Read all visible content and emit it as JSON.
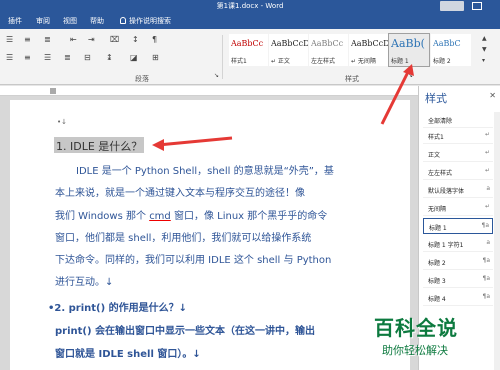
{
  "window": {
    "title": "第1课1.docx  -  Word"
  },
  "ribbon_tabs": [
    "插件",
    "审阅",
    "视图",
    "帮助"
  ],
  "tell_me": "操作说明搜索",
  "ribbon": {
    "group_paragraph": "段落",
    "group_styles": "样式",
    "styles": [
      {
        "sample": "AaBbCc",
        "name": "样式1"
      },
      {
        "sample": "AaBbCcD",
        "name": "↵ 正文"
      },
      {
        "sample": "AaBbCc",
        "name": "左左样式"
      },
      {
        "sample": "AaBbCcD",
        "name": "↵ 无间隔"
      },
      {
        "sample": "AaBb(",
        "name": "标题 1"
      },
      {
        "sample": "AaBbC",
        "name": "标题 2"
      }
    ]
  },
  "document": {
    "anchor": "•↓",
    "heading1": "1. IDLE  是什么？",
    "para1": [
      "IDLE 是一个 Python Shell，shell 的意思就是“外壳”，基",
      "本上来说，就是一个通过键入文本与程序交互的途径！像",
      "我们 Windows 那个 ",
      "cmd",
      " 窗口，像 Linux 那个黑乎乎的命令",
      "窗口，他们都是 shell，利用他们，我们就可以给操作系统",
      "下达命令。同样的，我们可以利用 IDLE 这个 shell 与 Python",
      "进行互动。↓"
    ],
    "heading2": "•2. print()  的作用是什么？↓",
    "para2": [
      "print()  会在输出窗口中显示一些文本（在这一讲中，输出",
      "窗口就是 IDLE shell 窗口）。↓"
    ]
  },
  "style_pane": {
    "title": "样式",
    "close": "✕",
    "items": [
      {
        "label": "全部清除",
        "mark": ""
      },
      {
        "label": "样式1",
        "mark": "↵"
      },
      {
        "label": "正文",
        "mark": "↵"
      },
      {
        "label": "左左样式",
        "mark": "↵"
      },
      {
        "label": "默认段落字体",
        "mark": "a"
      },
      {
        "label": "无间隔",
        "mark": "↵"
      },
      {
        "label": "标题 1",
        "mark": "¶a"
      },
      {
        "label": "标题 1 字符1",
        "mark": "a"
      },
      {
        "label": "标题 2",
        "mark": "¶a"
      },
      {
        "label": "标题 3",
        "mark": "¶a"
      },
      {
        "label": "标题 4",
        "mark": "¶a"
      }
    ]
  },
  "watermark": {
    "big": "百科全说",
    "small": "助你轻松解决"
  },
  "colors": {
    "accent": "#2b579a",
    "arrow": "#e53935",
    "selection": "#c7c7c7"
  }
}
